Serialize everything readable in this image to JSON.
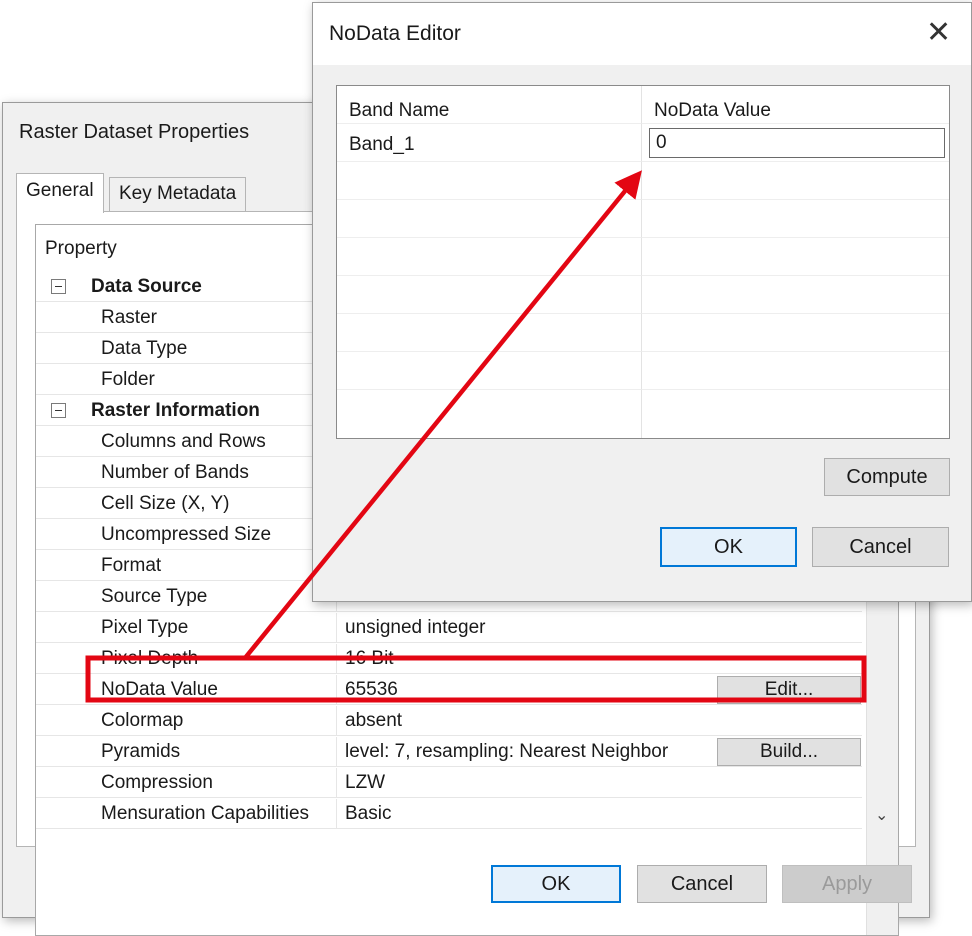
{
  "props_dialog": {
    "title": "Raster Dataset Properties",
    "tabs": [
      {
        "label": "General"
      },
      {
        "label": "Key Metadata"
      }
    ],
    "grid_header": "Property",
    "categories": [
      "Data Source",
      "Raster Information"
    ],
    "rows": [
      {
        "label": "Raster",
        "value": ""
      },
      {
        "label": "Data Type",
        "value": ""
      },
      {
        "label": "Folder",
        "value": ""
      },
      {
        "label": "Columns and Rows",
        "value": ""
      },
      {
        "label": "Number of Bands",
        "value": ""
      },
      {
        "label": "Cell Size (X, Y)",
        "value": ""
      },
      {
        "label": "Uncompressed Size",
        "value": ""
      },
      {
        "label": "Format",
        "value": ""
      },
      {
        "label": "Source Type",
        "value": ""
      },
      {
        "label": "Pixel Type",
        "value": "unsigned integer"
      },
      {
        "label": "Pixel Depth",
        "value": "16 Bit"
      },
      {
        "label": "NoData Value",
        "value": "65536",
        "button": "Edit..."
      },
      {
        "label": "Colormap",
        "value": "absent"
      },
      {
        "label": "Pyramids",
        "value": "level: 7, resampling: Nearest Neighbor",
        "button": "Build..."
      },
      {
        "label": "Compression",
        "value": "LZW"
      },
      {
        "label": "Mensuration Capabilities",
        "value": "Basic"
      }
    ],
    "buttons": {
      "ok": "OK",
      "cancel": "Cancel",
      "apply": "Apply"
    }
  },
  "nodata_editor": {
    "title": "NoData Editor",
    "close_glyph": "✕",
    "columns": [
      "Band Name",
      "NoData Value"
    ],
    "rows": [
      {
        "band": "Band_1",
        "value": "0"
      }
    ],
    "buttons": {
      "compute": "Compute",
      "ok": "OK",
      "cancel": "Cancel"
    }
  },
  "annotation": {
    "color": "#e30613"
  },
  "icons": {
    "scroll_down": "⌄"
  }
}
